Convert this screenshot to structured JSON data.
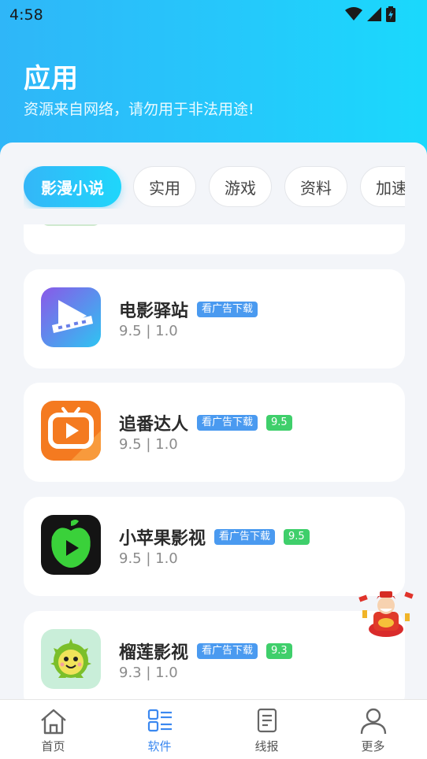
{
  "status_bar": {
    "time": "4:58"
  },
  "header": {
    "title": "应用",
    "subtitle": "资源来自网络，请勿用于非法用途!"
  },
  "tabs": [
    {
      "label": "影漫小说",
      "active": true
    },
    {
      "label": "实用",
      "active": false
    },
    {
      "label": "游戏",
      "active": false
    },
    {
      "label": "资料",
      "active": false
    },
    {
      "label": "加速",
      "active": false
    }
  ],
  "apps": [
    {
      "name": "电影驿站",
      "ad_badge": "看广告下载",
      "score_badge": null,
      "meta": "9.5 | 1.0",
      "icon": "film-play-icon"
    },
    {
      "name": "追番达人",
      "ad_badge": "看广告下载",
      "score_badge": "9.5",
      "meta": "9.5 | 1.0",
      "icon": "tv-play-icon"
    },
    {
      "name": "小苹果影视",
      "ad_badge": "看广告下载",
      "score_badge": "9.5",
      "meta": "9.5 | 1.0",
      "icon": "apple-play-icon"
    },
    {
      "name": "榴莲影视",
      "ad_badge": "看广告下载",
      "score_badge": "9.3",
      "meta": "9.3 | 1.0",
      "icon": "durian-icon"
    }
  ],
  "bottom_nav": [
    {
      "label": "首页",
      "icon": "home-icon",
      "active": false
    },
    {
      "label": "软件",
      "icon": "apps-list-icon",
      "active": true
    },
    {
      "label": "线报",
      "icon": "document-icon",
      "active": false
    },
    {
      "label": "更多",
      "icon": "user-icon",
      "active": false
    }
  ],
  "colors": {
    "header_gradient_start": "#2fb6f8",
    "header_gradient_end": "#1ad9fc",
    "ad_badge": "#4a9af0",
    "score_badge": "#3fcf6b",
    "nav_active": "#3b88f0"
  }
}
